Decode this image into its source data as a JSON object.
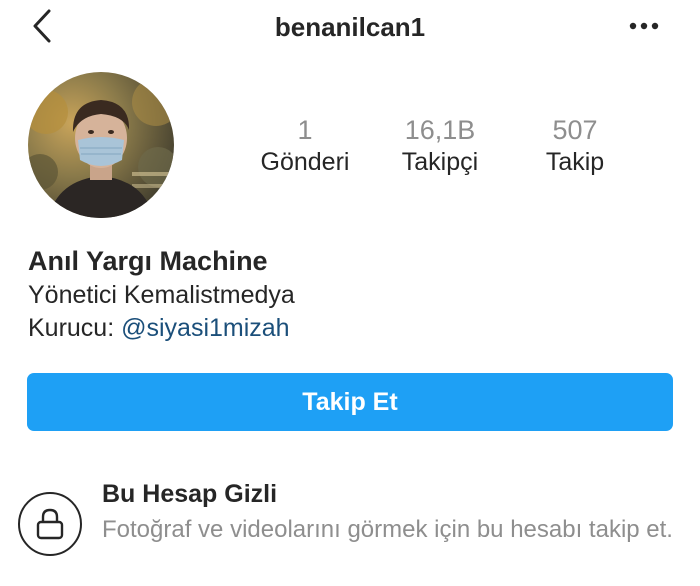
{
  "header": {
    "username": "benanilcan1",
    "back_icon": "chevron-left-icon",
    "more_icon": "more-horizontal-icon"
  },
  "profile": {
    "avatar_description": "profile-photo"
  },
  "stats": {
    "posts": {
      "value": "1",
      "label": "Gönderi"
    },
    "followers": {
      "value": "16,1B",
      "label": "Takipçi"
    },
    "following": {
      "value": "507",
      "label": "Takip"
    }
  },
  "bio": {
    "name": "Anıl Yargı Machine",
    "line1": "Yönetici Kemalistmedya",
    "line2_prefix": "Kurucu: ",
    "line2_mention": "@siyasi1mizah"
  },
  "follow_button": {
    "label": "Takip Et"
  },
  "private_notice": {
    "title": "Bu Hesap Gizli",
    "description": "Fotoğraf ve videolarını görmek için bu hesabı takip et.",
    "icon": "lock-icon"
  },
  "colors": {
    "accent_blue": "#1ea0f5",
    "link_blue": "#1b4f7a",
    "text_primary": "#262626",
    "text_secondary": "#8e8e8e"
  }
}
